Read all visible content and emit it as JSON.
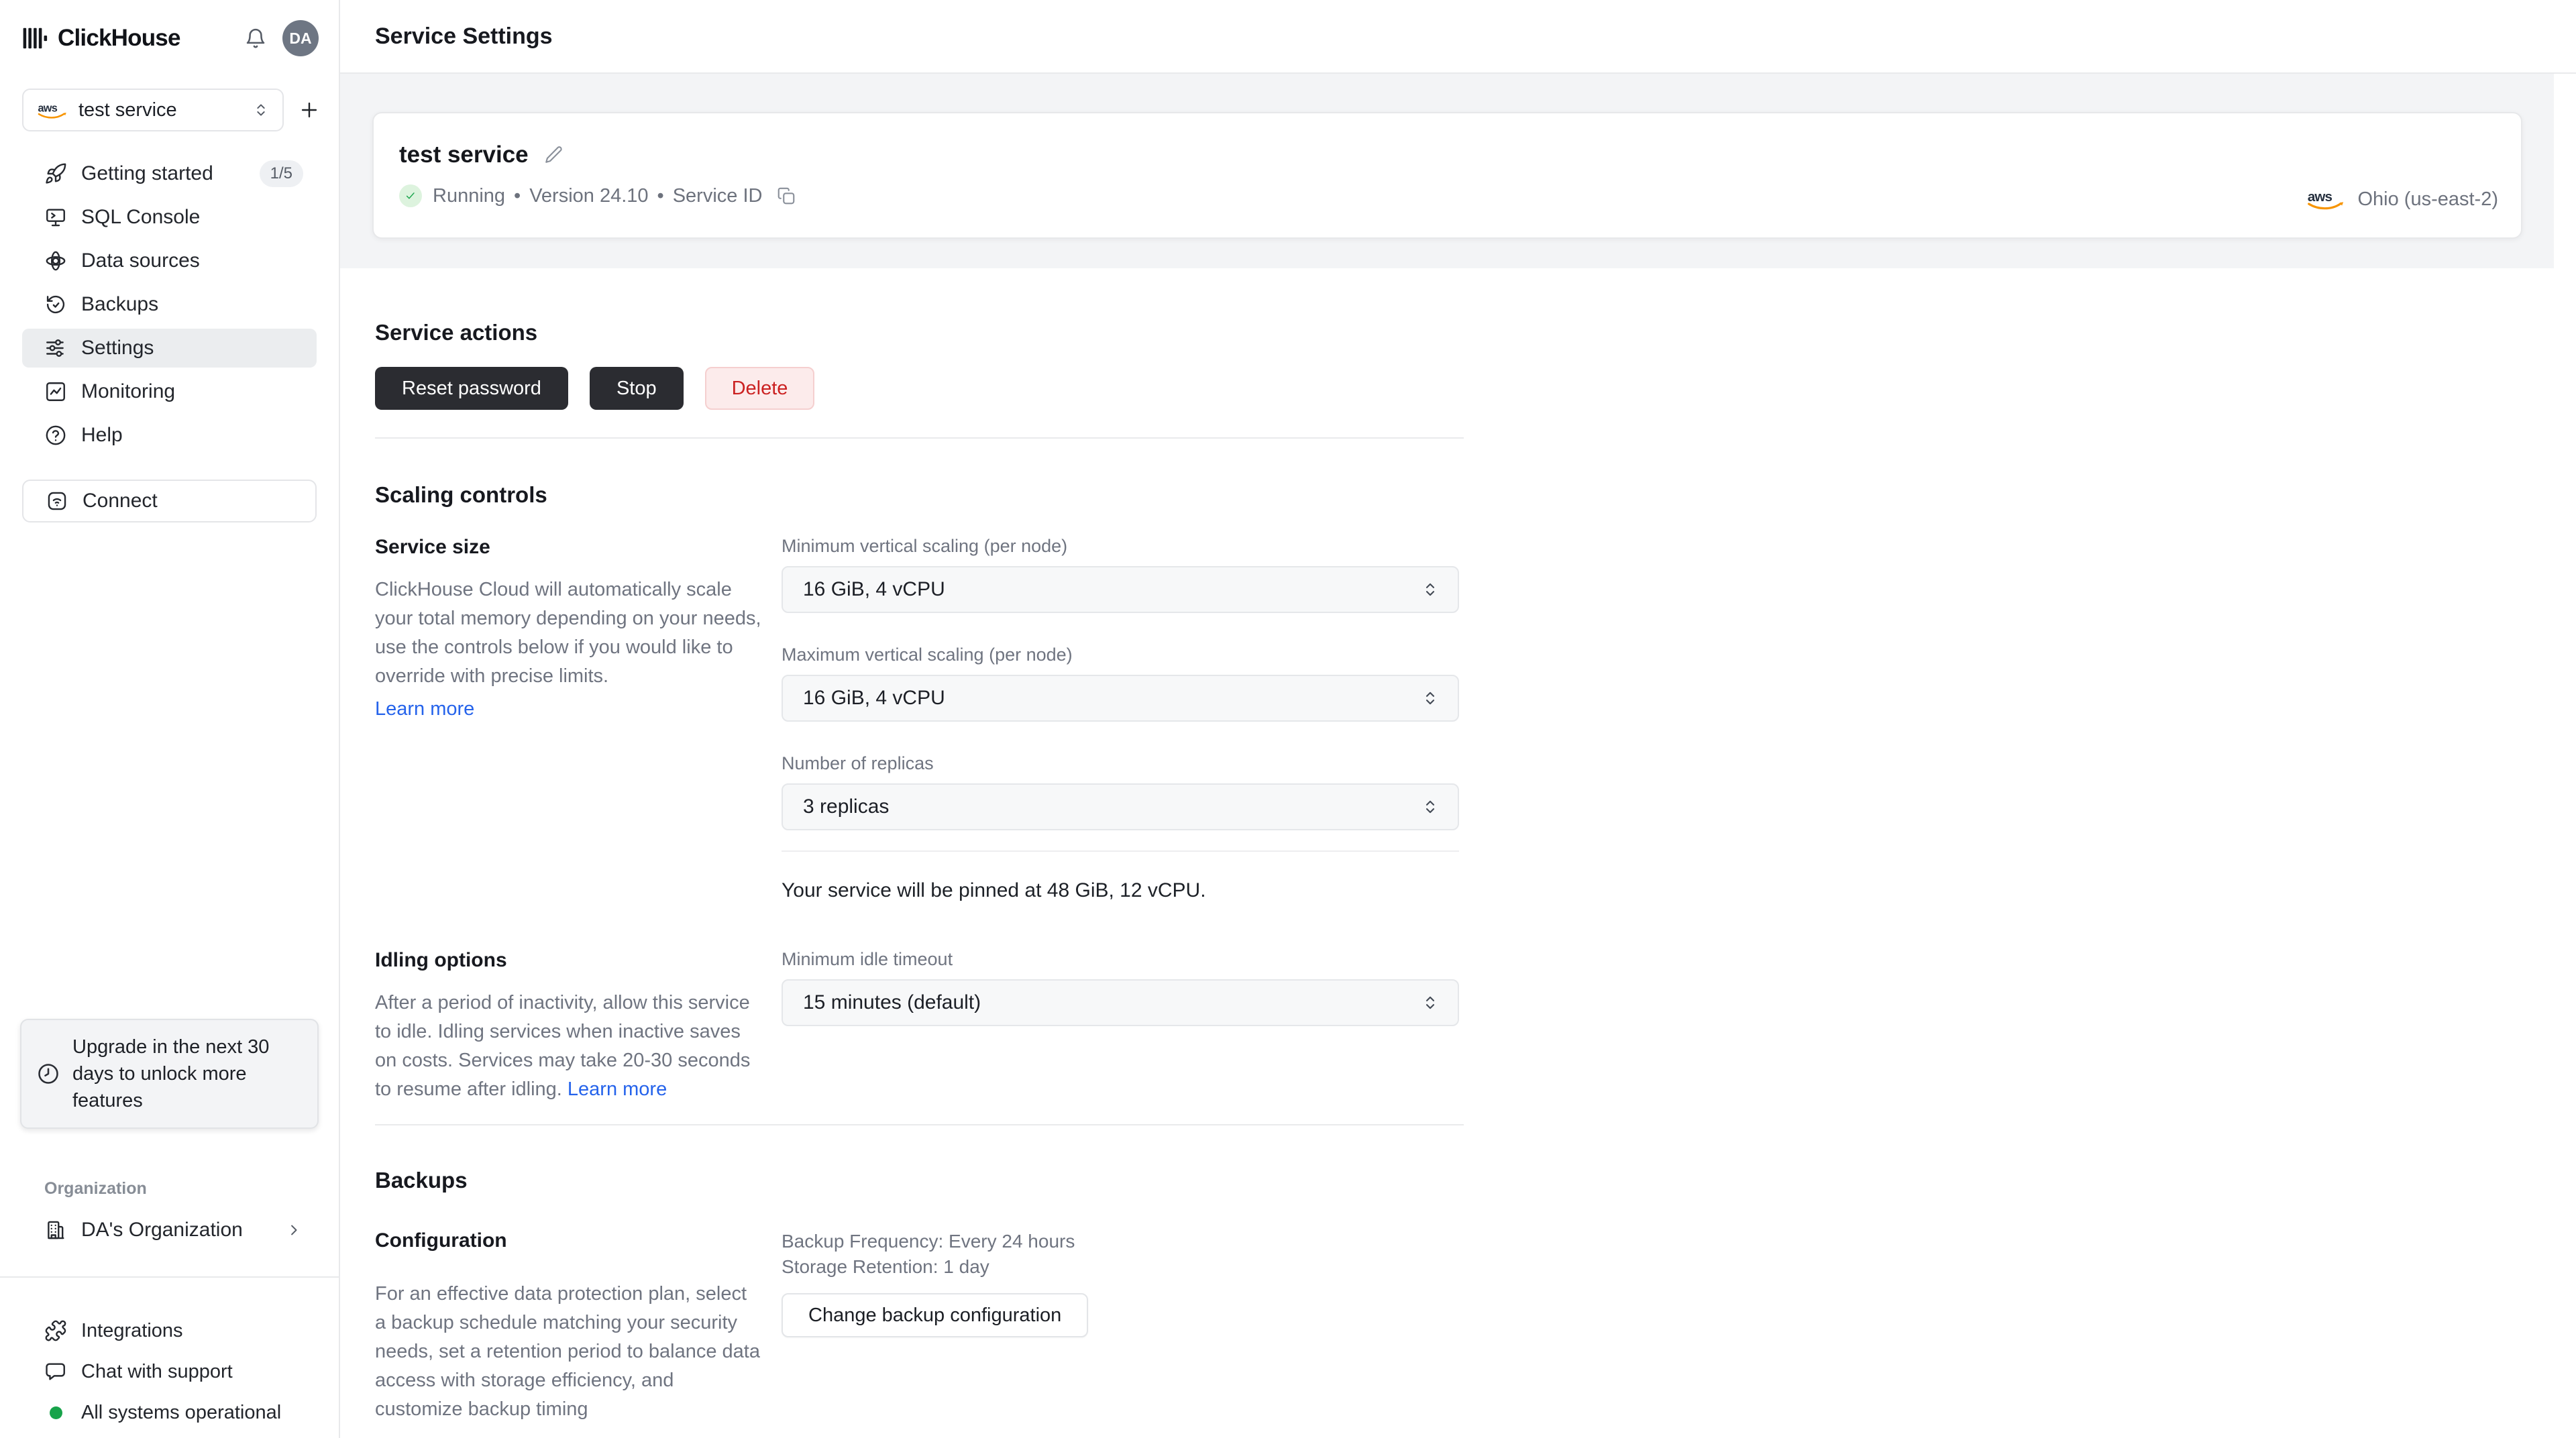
{
  "logos": {
    "aws": "aws"
  },
  "sidebar": {
    "brand": "ClickHouse",
    "avatar_initials": "DA",
    "service_selector": {
      "value": "test service"
    },
    "nav": [
      {
        "label": "Getting started",
        "badge": "1/5"
      },
      {
        "label": "SQL Console"
      },
      {
        "label": "Data sources"
      },
      {
        "label": "Backups"
      },
      {
        "label": "Settings"
      },
      {
        "label": "Monitoring"
      },
      {
        "label": "Help"
      }
    ],
    "connect_label": "Connect",
    "upgrade_notice": "Upgrade in the next 30 days to unlock more features",
    "organization": {
      "section_label": "Organization",
      "name": "DA's Organization"
    },
    "footer": [
      {
        "label": "Integrations"
      },
      {
        "label": "Chat with support"
      },
      {
        "label": "All systems operational"
      }
    ]
  },
  "header": {
    "title": "Service Settings"
  },
  "service_card": {
    "name": "test service",
    "status": "Running",
    "separator": "•",
    "version": "Version 24.10",
    "service_id_label": "Service ID",
    "region": "Ohio (us-east-2)"
  },
  "service_actions": {
    "title": "Service actions",
    "reset_password": "Reset password",
    "stop": "Stop",
    "delete": "Delete"
  },
  "scaling": {
    "title": "Scaling controls",
    "service_size": {
      "title": "Service size",
      "description": "ClickHouse Cloud will automatically scale your total memory depending on your needs, use the controls below if you would like to override with precise limits.",
      "learn_more": "Learn more"
    },
    "min_scaling_label": "Minimum vertical scaling (per node)",
    "min_scaling_value": "16 GiB, 4 vCPU",
    "max_scaling_label": "Maximum vertical scaling (per node)",
    "max_scaling_value": "16 GiB, 4 vCPU",
    "replicas_label": "Number of replicas",
    "replicas_value": "3 replicas",
    "pinned_note": "Your service will be pinned at 48 GiB, 12 vCPU."
  },
  "idling": {
    "title": "Idling options",
    "description": "After a period of inactivity, allow this service to idle. Idling services when inactive saves on costs. Services may take 20-30 seconds to resume after idling.",
    "learn_more": "Learn more",
    "timeout_label": "Minimum idle timeout",
    "timeout_value": "15 minutes (default)"
  },
  "backups": {
    "title": "Backups",
    "config_title": "Configuration",
    "description": "For an effective data protection plan, select a backup schedule matching your security needs, set a retention period to balance data access with storage efficiency, and customize backup timing",
    "frequency": "Backup Frequency: Every 24 hours",
    "retention": "Storage Retention: 1 day",
    "change_button": "Change backup configuration"
  },
  "colors": {
    "accent_blue": "#2563eb",
    "status_green": "#17a34a",
    "danger_red": "#cb2121",
    "aws_orange": "#f79400"
  }
}
